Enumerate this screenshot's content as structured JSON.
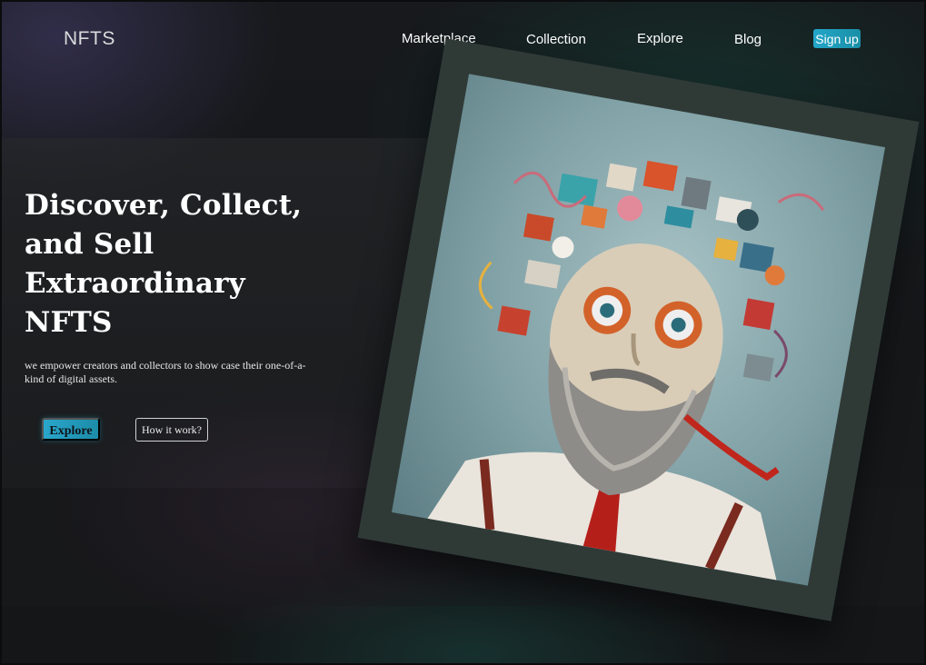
{
  "brand": {
    "logo": "NFTS"
  },
  "nav": {
    "items": [
      "Marketplace",
      "Collection",
      "Explore",
      "Blog"
    ],
    "signup_label": "Sign up"
  },
  "hero": {
    "title_lines": [
      "Discover, Collect,",
      "and Sell",
      "Extraordinary",
      "NFTS"
    ],
    "subtitle": "we empower creators and collectors to show case their one-of-a-kind of digital assets.",
    "primary_button": "Explore",
    "secondary_button": "How it work?"
  },
  "artwork": {
    "icon": "nft-portrait-artwork",
    "colors": {
      "background": "#8fb0b4",
      "mat": "#2f3a37",
      "accent": "#23a6c9"
    }
  }
}
